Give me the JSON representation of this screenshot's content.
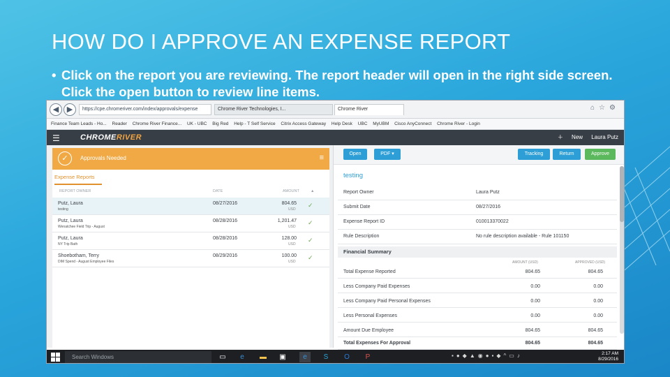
{
  "slide": {
    "title": "HOW DO I APPROVE AN EXPENSE REPORT",
    "bullet": "Click on the report you are reviewing.  The report header will open in the right side screen.  Click the open button to review line items."
  },
  "browser": {
    "url": "https://cpe.chromeriver.com/index/approvals/expense",
    "tabs": [
      "Chrome River Technologies, I...",
      "Chrome River"
    ],
    "bookmarks": [
      "Finance Team Leads - Ho...",
      "Reader",
      "Chrome River Finance...",
      "UK - UBC",
      "Big Red",
      "Help - T Self Service",
      "Citrix Access Gateway",
      "Help Desk",
      "UBC",
      "MyUBM",
      "Cisco AnyConnect",
      "Chrome River - Login"
    ]
  },
  "app": {
    "logo_a": "CHROME",
    "logo_b": "RIVER",
    "new_label": "New",
    "user": "Laura Putz",
    "approvals_label": "Approvals Needed",
    "list_tab": "Expense Reports",
    "columns": [
      "REPORT OWNER",
      "DATE",
      "AMOUNT"
    ],
    "rows": [
      {
        "name": "Putz, Laura",
        "sub": "testing",
        "date": "08/27/2016",
        "amount": "804.65",
        "currency": "USD"
      },
      {
        "name": "Putz, Laura",
        "sub": "Wenatchee Field Trip - August",
        "date": "08/28/2016",
        "amount": "1,201.47",
        "currency": "USD"
      },
      {
        "name": "Putz, Laura",
        "sub": "NY Trip Bath",
        "date": "08/28/2016",
        "amount": "128.00",
        "currency": "USD"
      },
      {
        "name": "Shoebotham, Terry",
        "sub": "DIM Spend - August Employee Files",
        "date": "08/29/2016",
        "amount": "100.00",
        "currency": "USD"
      }
    ],
    "buttons": {
      "open": "Open",
      "pdf": "PDF ▾",
      "tracking": "Tracking",
      "return": "Return",
      "approve": "Approve"
    },
    "report_title": "testing",
    "details": [
      {
        "k": "Report Owner",
        "v": "Laura Putz"
      },
      {
        "k": "Submit Date",
        "v": "08/27/2016"
      },
      {
        "k": "Expense Report ID",
        "v": "010013370022"
      },
      {
        "k": "Rule Description",
        "v": "No rule description available - Rule 101150"
      }
    ],
    "financial_title": "Financial Summary",
    "fin_headers": [
      "AMOUNT (USD)",
      "APPROVED (USD)"
    ],
    "financials": [
      {
        "k": "Total Expense Reported",
        "v1": "804.65",
        "v2": "804.65"
      },
      {
        "k": "Less Company Paid Expenses",
        "v1": "0.00",
        "v2": "0.00"
      },
      {
        "k": "Less Company Paid Personal Expenses",
        "v1": "0.00",
        "v2": "0.00"
      },
      {
        "k": "Less Personal Expenses",
        "v1": "0.00",
        "v2": "0.00"
      },
      {
        "k": "Amount Due Employee",
        "v1": "804.65",
        "v2": "804.65"
      },
      {
        "k": "Total Expenses For Approval",
        "v1": "804.65",
        "v2": "804.65"
      }
    ]
  },
  "taskbar": {
    "search": "Search Windows",
    "time": "2:17 AM",
    "date": "8/29/2016"
  }
}
